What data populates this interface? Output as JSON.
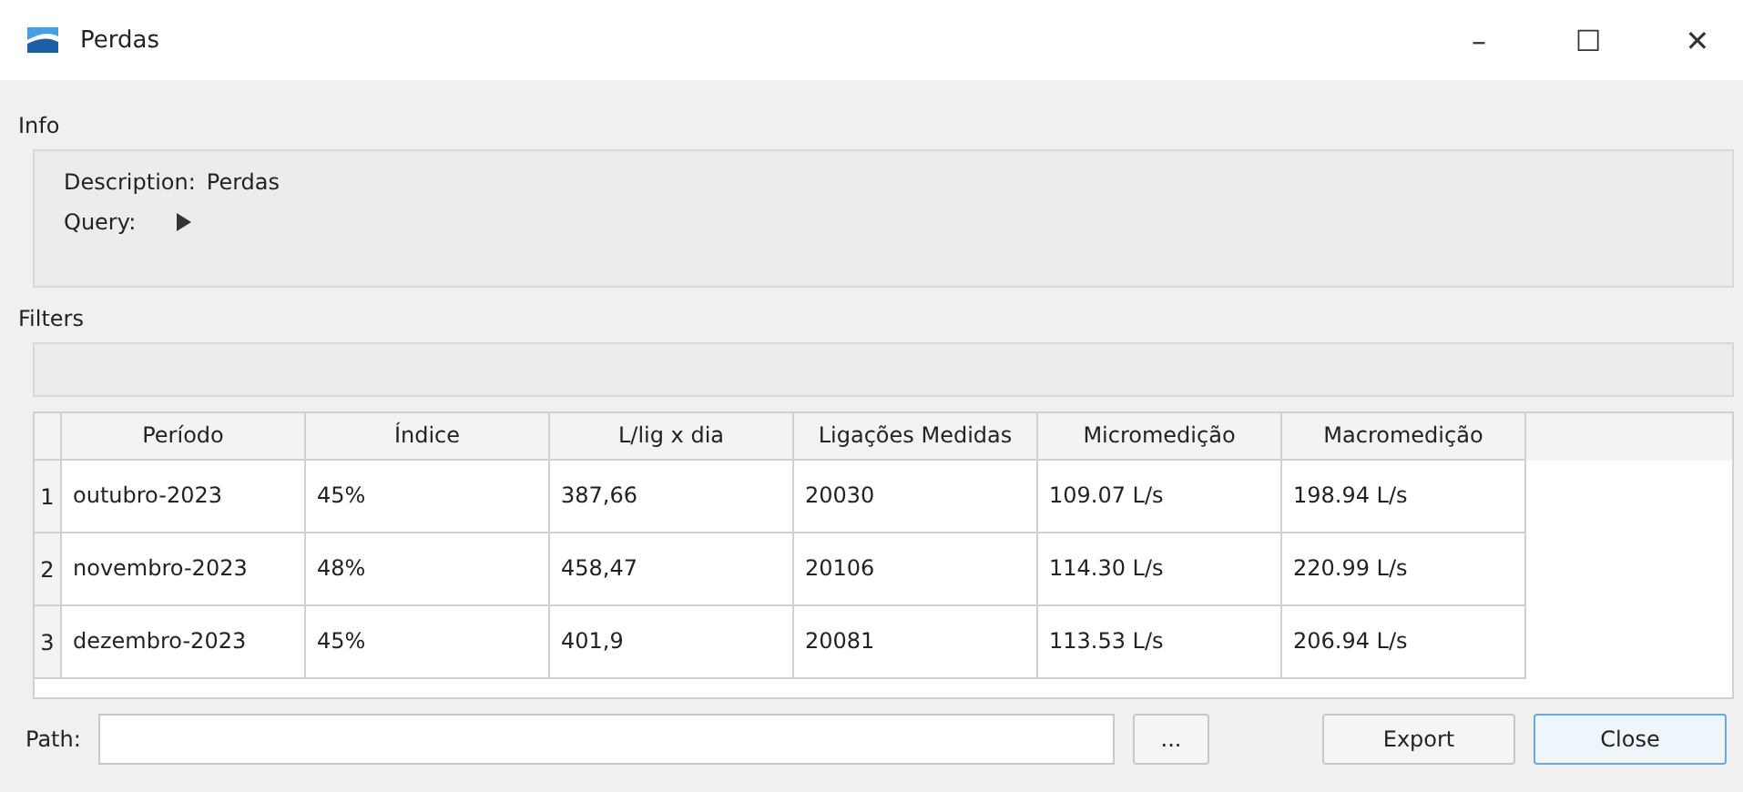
{
  "window": {
    "title": "Perdas",
    "controls": [
      "–",
      "☐",
      "✕"
    ]
  },
  "info": {
    "label": "Info",
    "description_label": "Description:",
    "description": "Perdas",
    "query_label": "Query:"
  },
  "filters": {
    "label": "Filters"
  },
  "table": {
    "columns": [
      "Período",
      "Índice",
      "L/lig x dia",
      "Ligações Medidas",
      "Micromedição",
      "Macromedição"
    ],
    "rows": [
      {
        "number": "1",
        "cells": [
          "outubro-2023",
          "45%",
          "387,66",
          "20030",
          "109.07 L/s",
          "198.94 L/s"
        ]
      },
      {
        "number": "2",
        "cells": [
          "novembro-2023",
          "48%",
          "458,47",
          "20106",
          "114.30 L/s",
          "220.99 L/s"
        ]
      },
      {
        "number": "3",
        "cells": [
          "dezembro-2023",
          "45%",
          "401,9",
          "20081",
          "113.53 L/s",
          "206.94 L/s"
        ]
      }
    ]
  },
  "path": {
    "label": "Path:",
    "browse": "..."
  },
  "buttons": [
    {
      "label": "Export",
      "default": false
    },
    {
      "label": "Close",
      "default": true
    }
  ]
}
